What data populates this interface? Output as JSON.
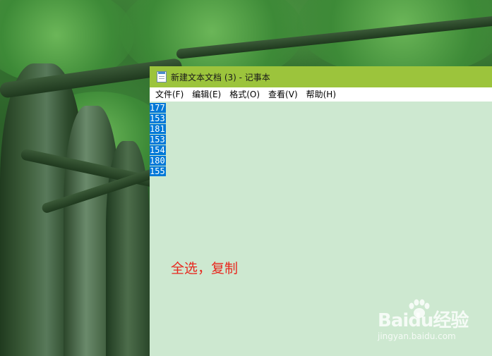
{
  "window": {
    "title": "新建文本文档 (3) - 记事本"
  },
  "menu": {
    "items": [
      {
        "label": "文件(F)"
      },
      {
        "label": "编辑(E)"
      },
      {
        "label": "格式(O)"
      },
      {
        "label": "查看(V)"
      },
      {
        "label": "帮助(H)"
      }
    ]
  },
  "editor": {
    "lines": [
      "177",
      "153",
      "181",
      "153",
      "154",
      "180",
      "155"
    ],
    "selection_color": "#0078d7",
    "background_color": "#cde8d0"
  },
  "annotation": {
    "text": "全选，复制",
    "color": "#e8271e"
  },
  "watermark": {
    "logo": "Baidu经验",
    "url": "jingyan.baidu.com"
  },
  "colors": {
    "titlebar": "#9cc43c"
  }
}
